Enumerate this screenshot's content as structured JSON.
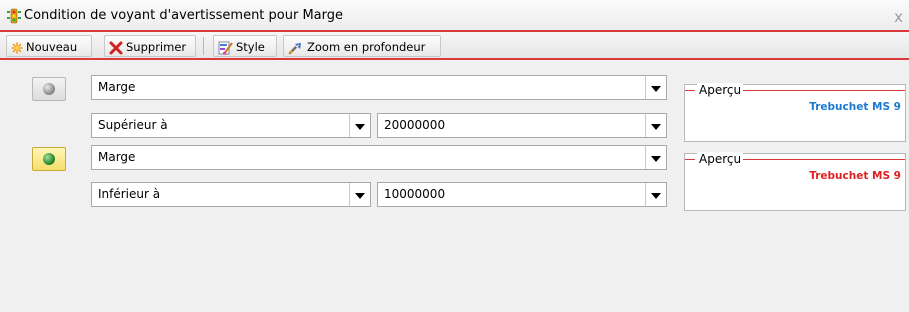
{
  "window": {
    "title": "Condition de voyant d'avertissement  pour  Marge",
    "close_glyph": "x"
  },
  "toolbar": {
    "new_label": "Nouveau",
    "delete_label": "Supprimer",
    "style_label": "Style",
    "drill_label": "Zoom en profondeur"
  },
  "conditions": [
    {
      "indicator": "grey-light-icon",
      "indicator_color": "#9a9a9a",
      "field": "Marge",
      "operator": "Supérieur à",
      "value": "20000000",
      "preview_legend": "Aperçu",
      "preview_text": "Trebuchet MS 9",
      "preview_color": "#1c79d2"
    },
    {
      "indicator": "green-light-icon",
      "indicator_color": "#2d8a2d",
      "field": "Marge",
      "operator": "Inférieur à",
      "value": "10000000",
      "preview_legend": "Aperçu",
      "preview_text": "Trebuchet MS 9",
      "preview_color": "#e02020"
    }
  ]
}
